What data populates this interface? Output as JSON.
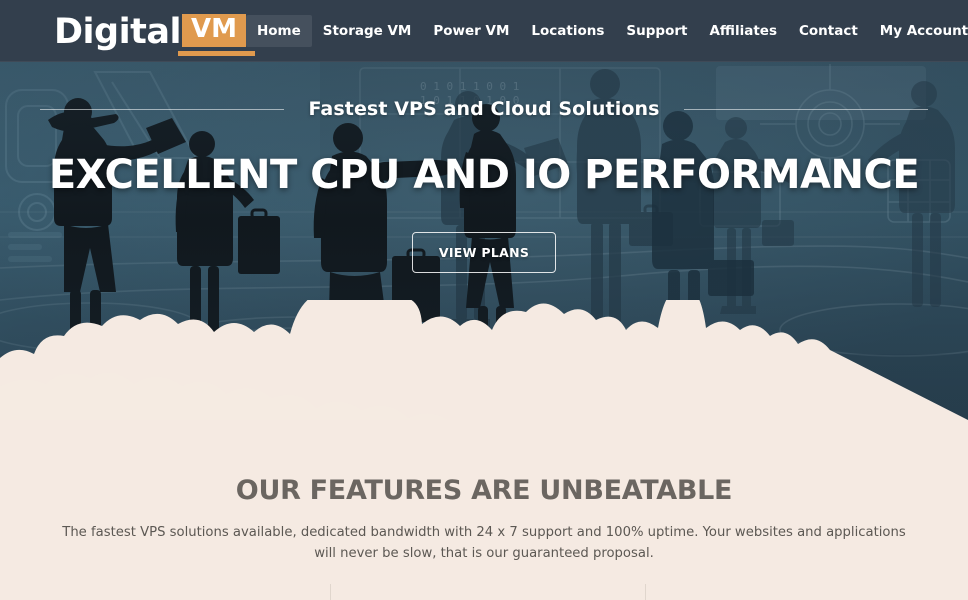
{
  "site": {
    "brand_word": "Digital",
    "brand_badge": "VM",
    "accent_color": "#E09A4E",
    "header_bg": "#333F4D",
    "cream_color": "#F5EAE2",
    "hero_bg": "#2E4A5A"
  },
  "nav": {
    "items": [
      {
        "label": "Home",
        "active": true
      },
      {
        "label": "Storage VM",
        "active": false
      },
      {
        "label": "Power VM",
        "active": false
      },
      {
        "label": "Locations",
        "active": false
      },
      {
        "label": "Support",
        "active": false
      },
      {
        "label": "Affiliates",
        "active": false
      },
      {
        "label": "Contact",
        "active": false
      },
      {
        "label": "My Account",
        "active": false
      }
    ]
  },
  "hero": {
    "tagline": "Fastest VPS and Cloud Solutions",
    "title": "EXCELLENT CPU AND IO PERFORMANCE",
    "cta_label": "VIEW PLANS"
  },
  "features": {
    "title": "OUR FEATURES ARE UNBEATABLE",
    "description": "The fastest VPS solutions available, dedicated bandwidth with 24 x 7 support and 100% uptime. Your websites and applications will never be slow, that is our guaranteed proposal."
  }
}
